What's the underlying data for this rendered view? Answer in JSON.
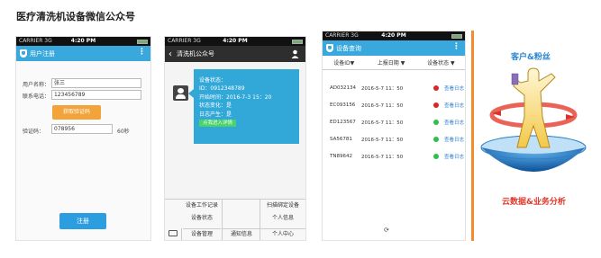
{
  "page_title": "医疗清洗机设备微信公众号",
  "status_bar": {
    "carrier": "CARRIER",
    "network": "3G",
    "time": "4:20 PM"
  },
  "screen_register": {
    "nav_title": "用户注册",
    "name_label": "用户名称：",
    "name_value": "张三",
    "phone_label": "联系电话：",
    "phone_value": "123456789",
    "get_code_button": "获取验证码",
    "code_label": "验证码：",
    "code_value": "078956",
    "countdown": "60秒",
    "register_button": "注册"
  },
  "screen_chat": {
    "nav_title": "清洗机公众号",
    "message_lines": [
      "设备状态：",
      "ID：0912348789",
      "开始时间：2016-7-3 15：20",
      "状态变化：是",
      "日志产生：是"
    ],
    "message_link": "点我进入详情",
    "menu": {
      "work_log": "设备工作记录",
      "scan_bind": "扫描绑定设备",
      "device_status": "设备状态",
      "personal_info": "个人信息",
      "device_mgmt": "设备管理",
      "notification": "通知信息",
      "personal_center": "个人中心"
    }
  },
  "screen_query": {
    "nav_title": "设备查询",
    "columns": [
      "设备ID▼",
      "上报日期 ▼",
      "设备状态 ▼"
    ],
    "rows": [
      {
        "id": "AD032134",
        "date": "2016-5-7 11：50",
        "status_color": "#e02424",
        "action": "查看日志"
      },
      {
        "id": "EC093156",
        "date": "2016-5-7 11：50",
        "status_color": "#e02424",
        "action": "查看日志"
      },
      {
        "id": "ED123567",
        "date": "2016-5-7 11：50",
        "status_color": "#2cc24a",
        "action": "查看日志"
      },
      {
        "id": "SA56781",
        "date": "2016-5-7 11：50",
        "status_color": "#2cc24a",
        "action": "查看日志"
      },
      {
        "id": "TN89642",
        "date": "2016-5-7 11：50",
        "status_color": "#2cc24a",
        "action": "查看日志"
      }
    ]
  },
  "graphic": {
    "top_label": "客户&粉丝",
    "bottom_label": "云数据&业务分析"
  }
}
